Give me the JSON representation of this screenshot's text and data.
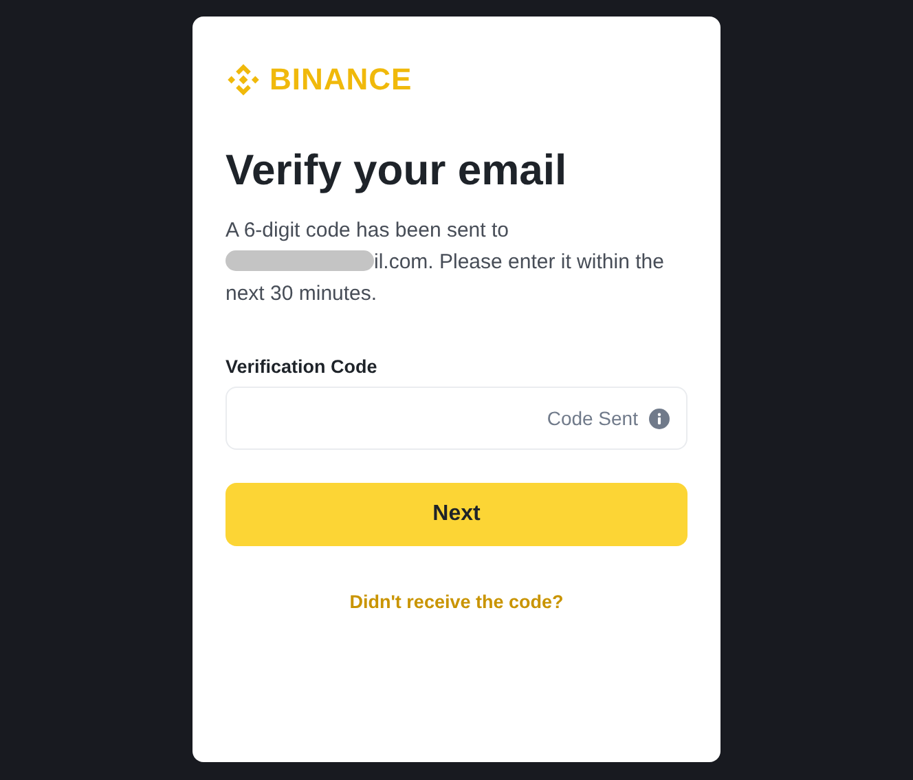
{
  "logo": {
    "text": "BINANCE"
  },
  "title": "Verify your email",
  "message": {
    "intro": "A 6-digit code has been sent to",
    "email_visible": "il.com. Please enter it within the",
    "closing": "next 30 minutes."
  },
  "field": {
    "label": "Verification Code",
    "status": "Code Sent"
  },
  "buttons": [
    {
      "label": "Next",
      "kind": "primary"
    }
  ],
  "link": "Didn't receive the code?"
}
